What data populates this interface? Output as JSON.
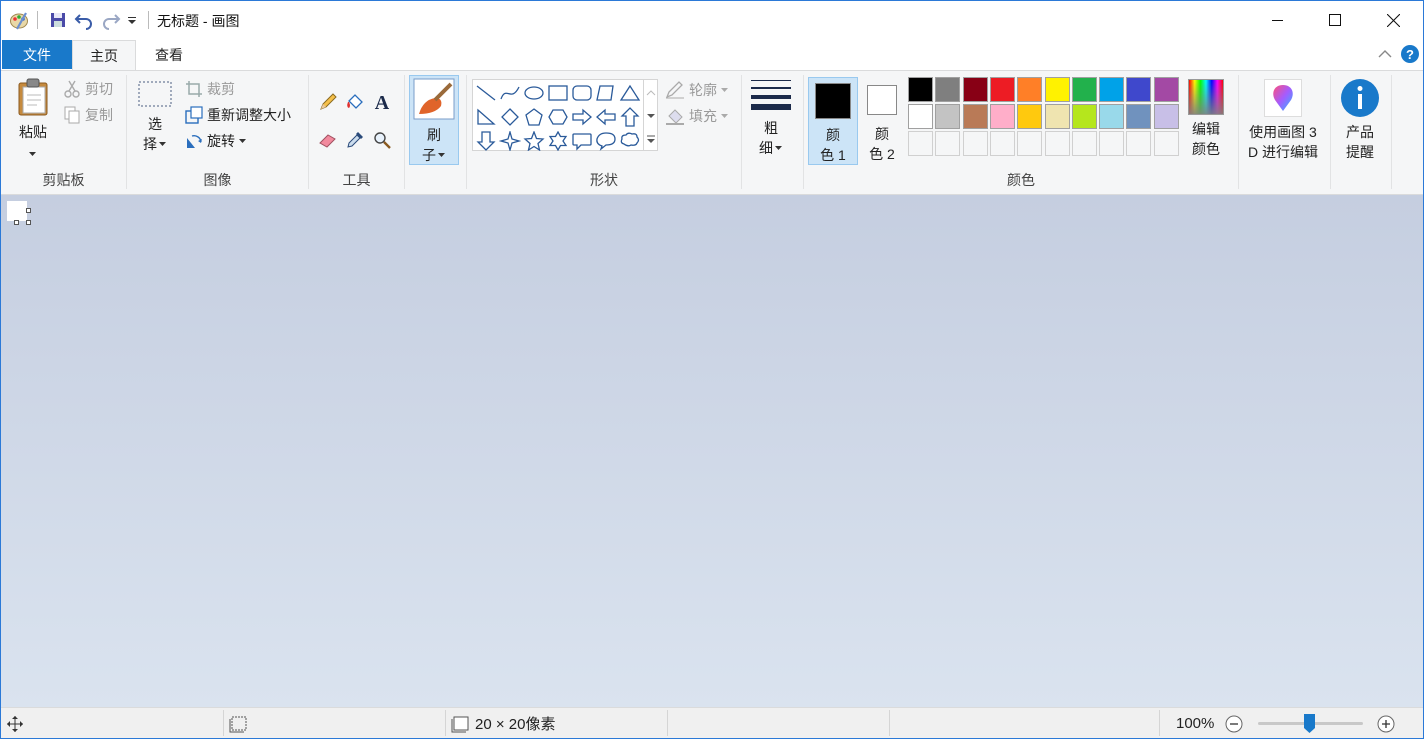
{
  "titlebar": {
    "title": "无标题 - 画图",
    "icons": [
      "paint-app-icon",
      "save-icon",
      "undo-icon",
      "redo-icon",
      "customize-qat-icon"
    ],
    "controls": [
      "minimize-icon",
      "maximize-icon",
      "close-icon"
    ]
  },
  "tabs": {
    "file": "文件",
    "home": "主页",
    "view": "查看",
    "active": "home"
  },
  "ribbon": {
    "clipboard": {
      "label": "剪贴板",
      "paste": "粘贴",
      "cut": "剪切",
      "copy": "复制"
    },
    "image": {
      "label": "图像",
      "select_line1": "选",
      "select_line2": "择",
      "crop": "裁剪",
      "resize": "重新调整大小",
      "rotate": "旋转"
    },
    "tools": {
      "label": "工具",
      "icons": [
        "pencil-icon",
        "fill-bucket-icon",
        "text-icon",
        "eraser-icon",
        "color-picker-icon",
        "magnifier-icon"
      ]
    },
    "brushes": {
      "line1": "刷",
      "line2": "子"
    },
    "shapes": {
      "label": "形状",
      "outline": "轮廓",
      "fill": "填充",
      "items": [
        "line",
        "curve",
        "oval",
        "rectangle",
        "rounded-rectangle",
        "polygon",
        "triangle",
        "right-triangle",
        "diamond",
        "pentagon",
        "hexagon",
        "right-arrow",
        "left-arrow",
        "up-arrow",
        "down-arrow",
        "four-point-star",
        "five-point-star",
        "six-point-star",
        "rounded-callout",
        "oval-callout",
        "cloud-callout"
      ]
    },
    "size": {
      "line1": "粗",
      "line2": "细"
    },
    "colors": {
      "label": "颜色",
      "color1_line1": "颜",
      "color1_line2": "色 1",
      "color1_value": "#000000",
      "color2_line1": "颜",
      "color2_line2": "色 2",
      "color2_value": "#ffffff",
      "edit_line1": "编辑",
      "edit_line2": "颜色",
      "palette_row1": [
        "#000000",
        "#7f7f7f",
        "#880015",
        "#ed1c24",
        "#ff7f27",
        "#fff200",
        "#22b14c",
        "#00a2e8",
        "#3f48cc",
        "#a349a4"
      ],
      "palette_row2": [
        "#ffffff",
        "#c3c3c3",
        "#b97a57",
        "#ffaec9",
        "#ffc90e",
        "#efe4b0",
        "#b5e61d",
        "#99d9ea",
        "#7092be",
        "#c8bfe7"
      ]
    },
    "paint3d": {
      "line1": "使用画图 3",
      "line2": "D 进行编辑"
    },
    "product_alert": {
      "line1": "产品",
      "line2": "提醒"
    }
  },
  "status": {
    "canvas_size": "20 × 20像素",
    "zoom": "100%",
    "zoom_level_percent": 100
  }
}
